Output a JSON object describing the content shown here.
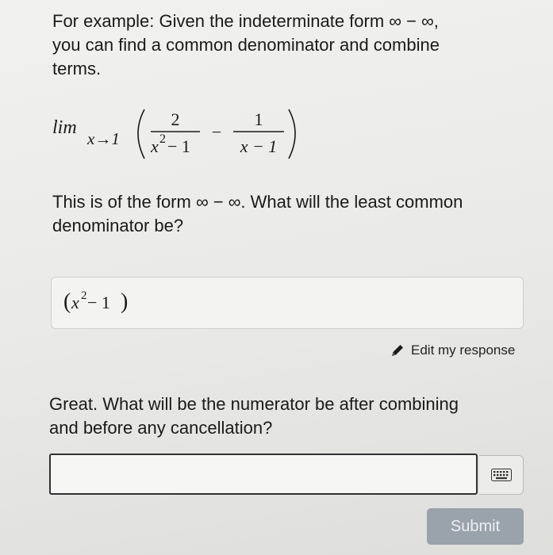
{
  "intro": {
    "line1": "For example: Given the indeterminate form ∞ − ∞,",
    "line2": "you can find a common denominator and combine",
    "line3": "terms."
  },
  "limit_expression": {
    "lim": "lim",
    "subscript": "x→1",
    "frac1_num": "2",
    "frac1_den_base": "x",
    "frac1_den_exp": "2",
    "frac1_den_rest": " − 1",
    "minus": "−",
    "frac2_num": "1",
    "frac2_den": "x − 1"
  },
  "question1": {
    "line1": "This is of the form ∞ − ∞.  What will the least common",
    "line2": "denominator be?"
  },
  "previous_answer": {
    "open": "(",
    "base": "x",
    "exp": "2",
    "rest": " − 1",
    "close": ")"
  },
  "edit_link": {
    "label": "Edit my response"
  },
  "question2": {
    "line1": "Great.  What will be the numerator be after combining",
    "line2": "and before any cancellation?"
  },
  "response_input": {
    "value": "",
    "placeholder": ""
  },
  "submit_button": {
    "label": "Submit"
  }
}
